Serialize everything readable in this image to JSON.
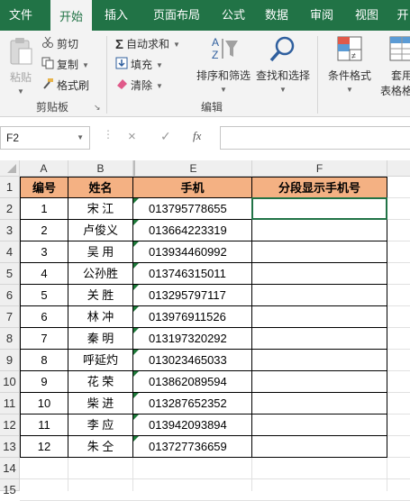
{
  "tabs": [
    "文件",
    "开始",
    "插入",
    "页面布局",
    "公式",
    "数据",
    "审阅",
    "视图",
    "开"
  ],
  "ribbon": {
    "paste": "粘贴",
    "cut": "剪切",
    "copy": "复制",
    "format_painter": "格式刷",
    "clipboard_group": "剪贴板",
    "autosum": "自动求和",
    "fill": "填充",
    "clear": "清除",
    "sort_filter_line1": "排序和筛选",
    "find_select_line1": "查找和选择",
    "editing_group": "编辑",
    "cond_format": "条件格式",
    "table_format_line1": "套用",
    "table_format_line2": "表格格式"
  },
  "formula_bar": {
    "name_box": "F2",
    "cancel": "×",
    "enter": "✓",
    "fx": "fx",
    "formula": ""
  },
  "columns": [
    "A",
    "B",
    "E",
    "F"
  ],
  "headers": {
    "id": "编号",
    "name": "姓名",
    "phone": "手机",
    "segmented": "分段显示手机号"
  },
  "row_numbers": [
    "1",
    "2",
    "3",
    "4",
    "5",
    "6",
    "7",
    "8",
    "9",
    "10",
    "11",
    "12",
    "13",
    "14",
    "15"
  ],
  "rows": [
    {
      "id": "1",
      "name": "宋 江",
      "phone": "013795778655"
    },
    {
      "id": "2",
      "name": "卢俊义",
      "phone": "013664223319"
    },
    {
      "id": "3",
      "name": "吴 用",
      "phone": "013934460992"
    },
    {
      "id": "4",
      "name": "公孙胜",
      "phone": "013746315011"
    },
    {
      "id": "5",
      "name": "关 胜",
      "phone": "013295797117"
    },
    {
      "id": "6",
      "name": "林 冲",
      "phone": "013976911526"
    },
    {
      "id": "7",
      "name": "秦 明",
      "phone": "013197320292"
    },
    {
      "id": "8",
      "name": "呼延灼",
      "phone": "013023465033"
    },
    {
      "id": "9",
      "name": "花 荣",
      "phone": "013862089594"
    },
    {
      "id": "10",
      "name": "柴 进",
      "phone": "013287652352"
    },
    {
      "id": "11",
      "name": "李 应",
      "phone": "013942093894"
    },
    {
      "id": "12",
      "name": "朱 仝",
      "phone": "013727736659"
    }
  ]
}
